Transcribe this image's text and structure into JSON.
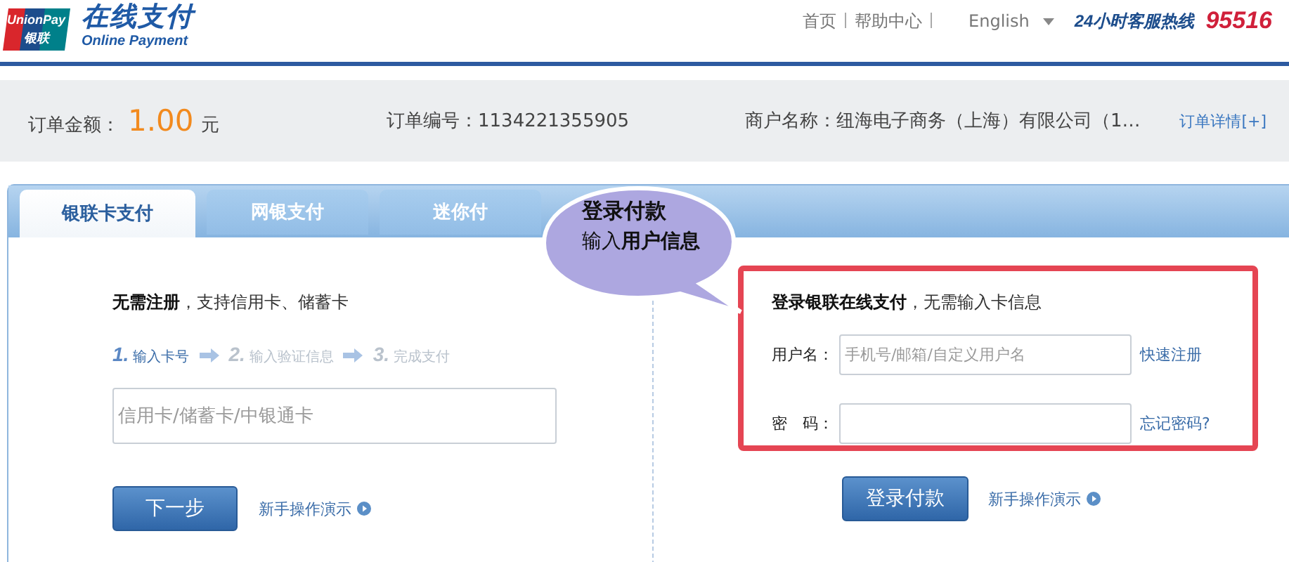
{
  "header": {
    "logo_en": "UnionPay",
    "logo_cn": "银联",
    "title": "在线支付",
    "subtitle": "Online Payment",
    "nav": [
      {
        "label": "首页"
      },
      {
        "label": "帮助中心"
      }
    ],
    "language": "English",
    "hotline_label": "24小时客服热线",
    "hotline_number": "95516"
  },
  "order": {
    "amount_label": "订单金额：",
    "amount": "1.00",
    "currency": "元",
    "number_label": "订单编号：",
    "number": "1134221355905",
    "merchant_label": "商户名称：",
    "merchant": "纽海电子商务（上海）有限公司（1…",
    "details_link": "订单详情[+]"
  },
  "tabs": [
    {
      "label": "银联卡支付",
      "selected": true
    },
    {
      "label": "网银支付",
      "selected": false
    },
    {
      "label": "迷你付",
      "selected": false
    }
  ],
  "card_pay": {
    "heading": "**无需注册**，支持信用卡、储蓄卡",
    "steps": [
      {
        "number": "1.",
        "label": "输入卡号",
        "active": true
      },
      {
        "number": "2.",
        "label": "输入验证信息",
        "active": false
      },
      {
        "number": "3.",
        "label": "完成支付",
        "active": false
      }
    ],
    "card_field": {
      "placeholder": "信用卡/储蓄卡/中银通卡"
    },
    "next_button": "下一步",
    "demo_link": "新手操作演示"
  },
  "login": {
    "heading": "**登录银联在线支付**，无需输入卡信息",
    "username_label": "用户名：",
    "username_field": {
      "placeholder": "手机号/邮箱/自定义用户名"
    },
    "register_link": "快速注册",
    "password_label": "密　码：",
    "forgot_link": "忘记密码?",
    "login_button": "登录付款",
    "demo_link": "新手操作演示"
  },
  "callout": {
    "title": "登录付款",
    "text": "输入**用户信息**"
  }
}
